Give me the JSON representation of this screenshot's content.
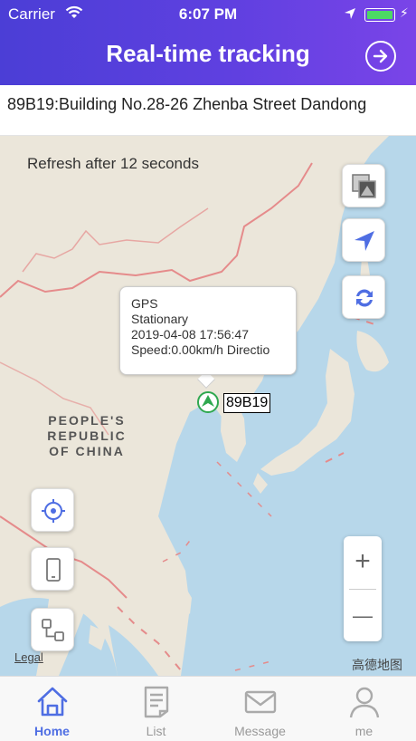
{
  "status_bar": {
    "carrier": "Carrier",
    "time": "6:07 PM"
  },
  "header": {
    "title": "Real-time tracking",
    "exit_icon": "exit-circle-arrow-icon"
  },
  "address": "89B19:Building No.28-26 Zhenba Street Dandong",
  "map": {
    "refresh_text": "Refresh after 12 seconds",
    "country_label": "PEOPLE'S REPUBLIC OF CHINA",
    "legal": "Legal",
    "provider": "高德地图",
    "popup": {
      "line1": "GPS",
      "line2": "Stationary",
      "line3": "2019-04-08 17:56:47",
      "line4": "Speed:0.00km/h Directio"
    },
    "vehicle_label": "89B19",
    "zoom_in": "+",
    "zoom_out": "—",
    "accent_color": "#4f6ee3"
  },
  "tabs": [
    {
      "label": "Home",
      "icon": "home-icon",
      "active": true
    },
    {
      "label": "List",
      "icon": "list-icon",
      "active": false
    },
    {
      "label": "Message",
      "icon": "message-icon",
      "active": false
    },
    {
      "label": "me",
      "icon": "user-icon",
      "active": false
    }
  ]
}
